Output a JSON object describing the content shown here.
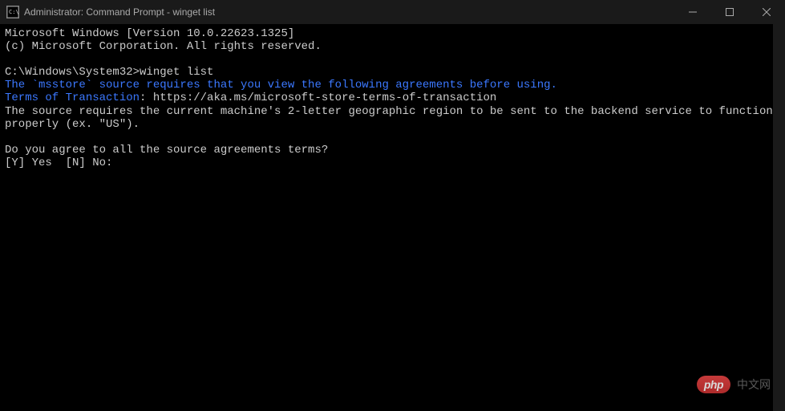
{
  "window": {
    "title": "Administrator: Command Prompt - winget  list",
    "icon_label": "cmd-icon"
  },
  "terminal": {
    "line1": "Microsoft Windows [Version 10.0.22623.1325]",
    "line2": "(c) Microsoft Corporation. All rights reserved.",
    "prompt_path": "C:\\Windows\\System32>",
    "command": "winget list",
    "msg_msstore": "The `msstore` source requires that you view the following agreements before using.",
    "terms_label": "Terms of Transaction",
    "terms_colon": ": ",
    "terms_url": "https://aka.ms/microsoft-store-terms-of-transaction",
    "msg_region": "The source requires the current machine's 2-letter geographic region to be sent to the backend service to function properly (ex. \"US\").",
    "question": "Do you agree to all the source agreements terms?",
    "options": "[Y] Yes  [N] No: "
  },
  "watermark": {
    "badge": "php",
    "text": "中文网"
  }
}
